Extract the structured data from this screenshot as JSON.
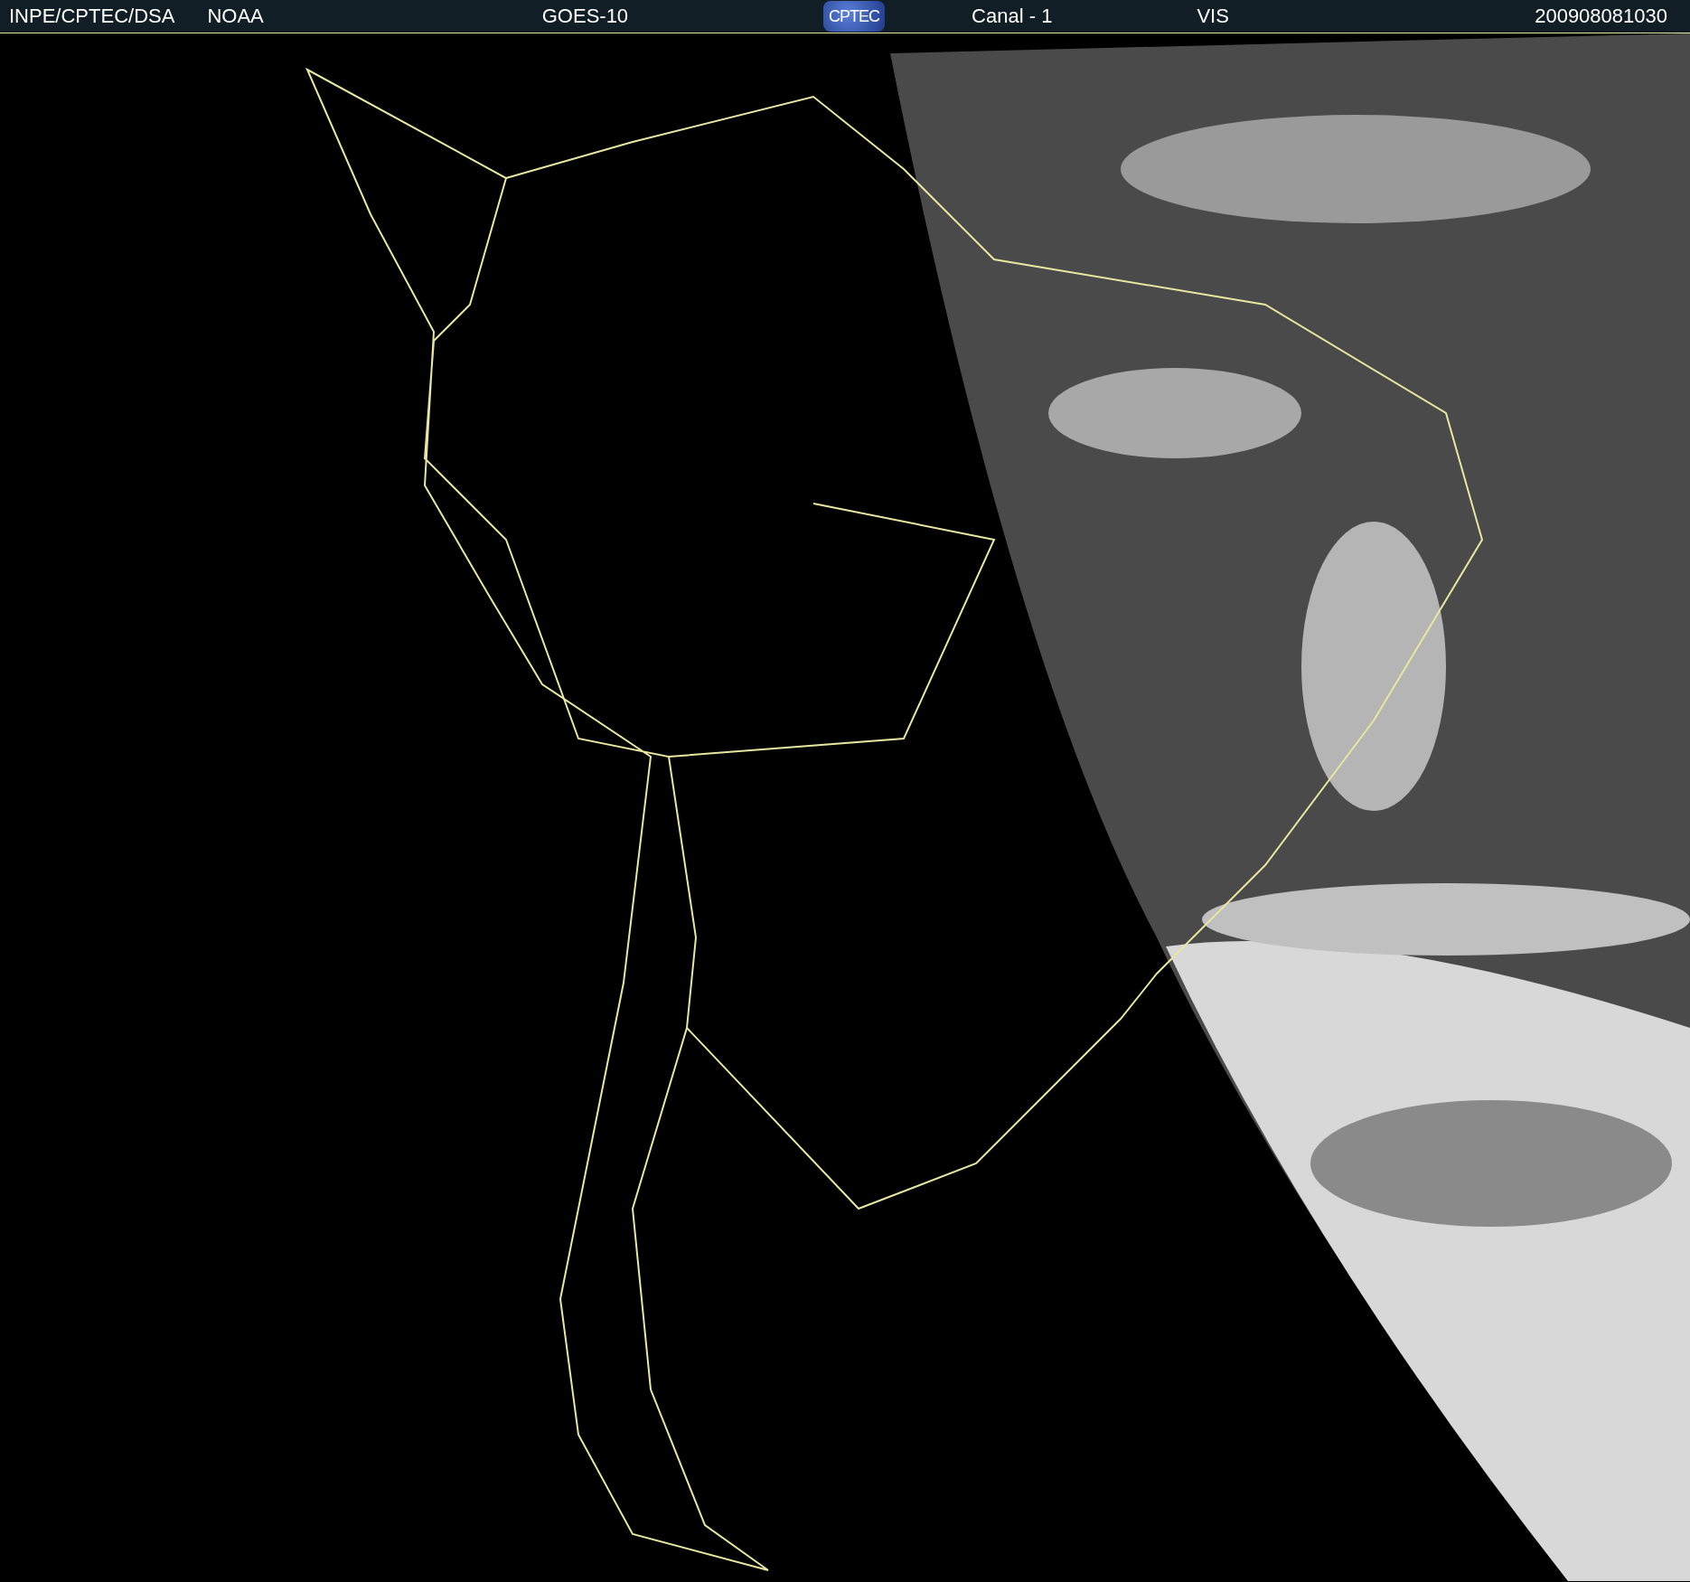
{
  "header": {
    "source": "INPE/CPTEC/DSA",
    "agency": "NOAA",
    "satellite": "GOES-10",
    "logo": "CPTEC",
    "channel": "Canal - 1",
    "band": "VIS",
    "timestamp": "200908081030"
  }
}
